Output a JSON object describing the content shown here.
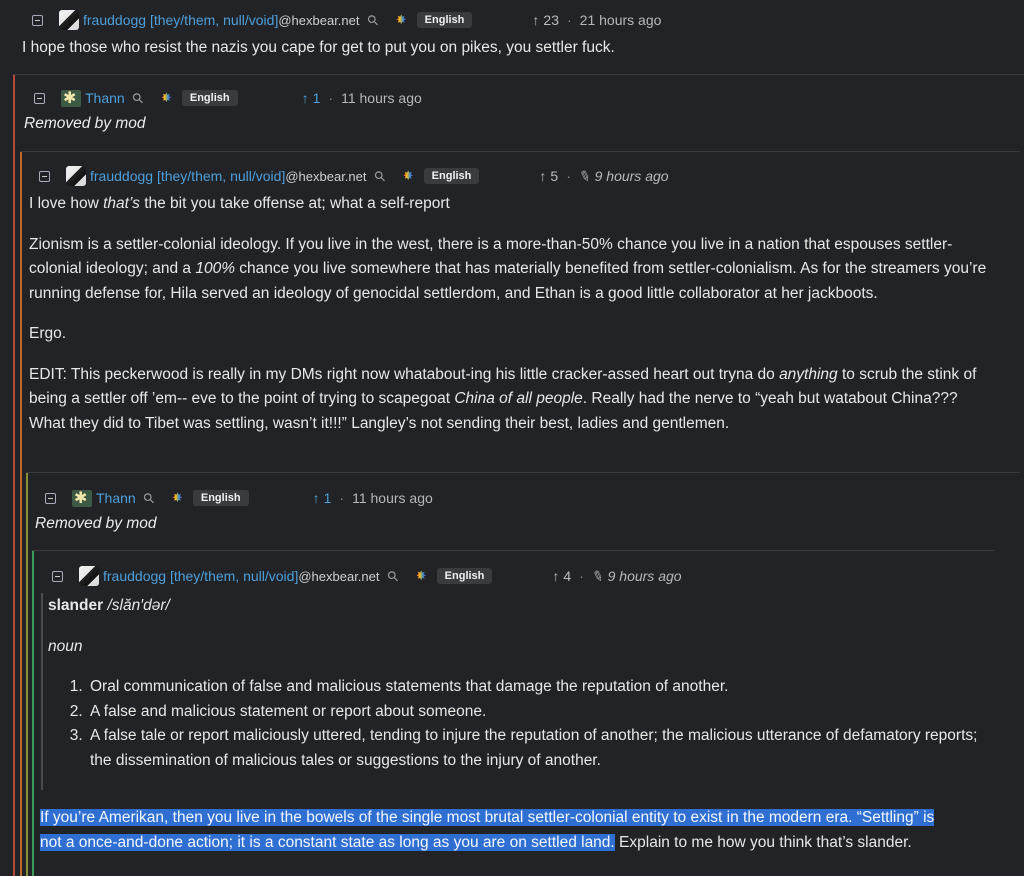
{
  "common": {
    "language_label": "English",
    "home_domain": "@hexbear.net"
  },
  "c1": {
    "author": "frauddogg [they/them, null/void]",
    "votes": "23",
    "time": "21 hours ago",
    "body": "I hope those who resist the nazis you cape for get to put you on pikes, you settler fuck."
  },
  "c2": {
    "author": "Thann",
    "votes": "1",
    "time": "11 hours ago",
    "body": "Removed by mod"
  },
  "c3": {
    "author": "frauddogg [they/them, null/void]",
    "votes": "5",
    "time": "9 hours ago",
    "p1_a": "I love how ",
    "p1_em": "that’s",
    "p1_b": " the bit you take offense at; what a self-report",
    "p2_a": "Zionism is a settler-colonial ideology. If you live in the west, there is a more-than-50% chance you live in a nation that espouses settler-colonial ideology; and a ",
    "p2_em": "100%",
    "p2_b": " chance you live somewhere that has materially benefited from settler-colonialism. As for the streamers you’re running defense for, Hila served an ideology of genocidal settlerdom, and Ethan is a good little collaborator at her jackboots.",
    "p3": "Ergo.",
    "p4_a": "EDIT: This peckerwood is really in my DMs right now whatabout-ing his little cracker-assed heart out tryna do ",
    "p4_em1": "anything",
    "p4_b": " to scrub the stink of being a settler off ’em-- eve to the point of trying to scapegoat ",
    "p4_em2": "China of all people",
    "p4_c": ". Really had the nerve to “yeah but watabout China??? What they did to Tibet was settling, wasn’t it!!!” Langley’s not sending their best, ladies and gentlemen."
  },
  "c4": {
    "author": "Thann",
    "votes": "1",
    "time": "11 hours ago",
    "body": "Removed by mod"
  },
  "c5": {
    "author": "frauddogg [they/them, null/void]",
    "votes": "4",
    "time": "9 hours ago",
    "word": "slander",
    "pron": "/slăn′dər/",
    "pos": "noun",
    "defs": [
      "Oral communication of false and malicious statements that damage the reputation of another.",
      "A false and malicious statement or report about someone.",
      "A false tale or report maliciously uttered, tending to injure the reputation of another; the malicious utterance of defamatory reports; the dissemination of malicious tales or suggestions to the injury of another."
    ],
    "highlight_line1": "If you’re Amerikan, then you live in the bowels of the single most brutal settler-colonial entity to exist in the modern era. “Settling” is",
    "highlight_line2": "not a once-and-done action; it is a constant state as long as you are on settled land.",
    "tail": " Explain to me how you think that’s slander."
  },
  "colors": {
    "background": "#222326",
    "link": "#4d9fdb",
    "thread_line_1": "#c0392b",
    "thread_line_2": "#d35400",
    "thread_line_3": "#7f8c3a",
    "thread_line_4": "#27ae60",
    "selection": "#2f6fd1"
  }
}
